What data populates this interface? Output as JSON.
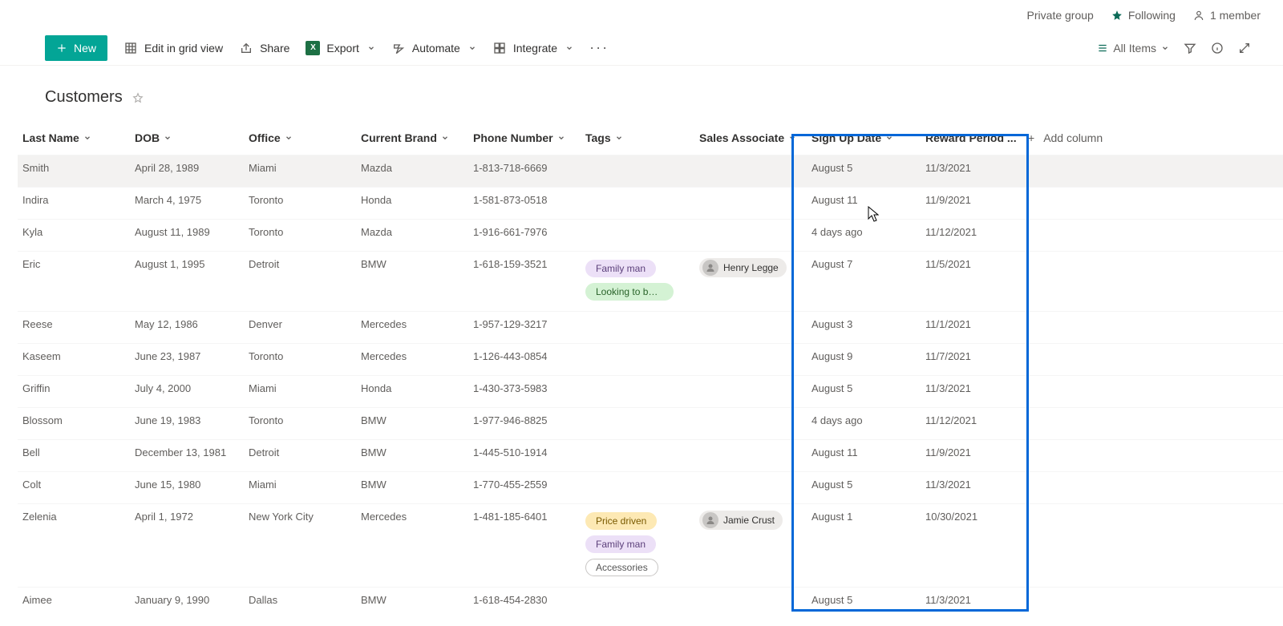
{
  "suite": {
    "private_label": "Private group",
    "following_label": "Following",
    "members_label": "1 member"
  },
  "cmdbar": {
    "new": "New",
    "edit_grid": "Edit in grid view",
    "share": "Share",
    "export": "Export",
    "automate": "Automate",
    "integrate": "Integrate",
    "view_label": "All Items"
  },
  "list": {
    "title": "Customers"
  },
  "columns": {
    "last_name": "Last Name",
    "dob": "DOB",
    "office": "Office",
    "brand": "Current Brand",
    "phone": "Phone Number",
    "tags": "Tags",
    "assoc": "Sales Associate",
    "signup": "Sign Up Date",
    "reward": "Reward Period ...",
    "addcol": "Add column"
  },
  "tag_labels": {
    "family": "Family man",
    "looking": "Looking to buy s...",
    "price": "Price driven",
    "acc": "Accessories"
  },
  "people": {
    "henry": "Henry Legge",
    "jamie": "Jamie Crust"
  },
  "rows": [
    {
      "ln": "Smith",
      "dob": "April 28, 1989",
      "office": "Miami",
      "brand": "Mazda",
      "phone": "1-813-718-6669",
      "tags": [],
      "assoc": "",
      "signup": "August 5",
      "reward": "11/3/2021"
    },
    {
      "ln": "Indira",
      "dob": "March 4, 1975",
      "office": "Toronto",
      "brand": "Honda",
      "phone": "1-581-873-0518",
      "tags": [],
      "assoc": "",
      "signup": "August 11",
      "reward": "11/9/2021"
    },
    {
      "ln": "Kyla",
      "dob": "August 11, 1989",
      "office": "Toronto",
      "brand": "Mazda",
      "phone": "1-916-661-7976",
      "tags": [],
      "assoc": "",
      "signup": "4 days ago",
      "reward": "11/12/2021"
    },
    {
      "ln": "Eric",
      "dob": "August 1, 1995",
      "office": "Detroit",
      "brand": "BMW",
      "phone": "1-618-159-3521",
      "tags": [
        "family",
        "looking"
      ],
      "assoc": "henry",
      "signup": "August 7",
      "reward": "11/5/2021"
    },
    {
      "ln": "Reese",
      "dob": "May 12, 1986",
      "office": "Denver",
      "brand": "Mercedes",
      "phone": "1-957-129-3217",
      "tags": [],
      "assoc": "",
      "signup": "August 3",
      "reward": "11/1/2021"
    },
    {
      "ln": "Kaseem",
      "dob": "June 23, 1987",
      "office": "Toronto",
      "brand": "Mercedes",
      "phone": "1-126-443-0854",
      "tags": [],
      "assoc": "",
      "signup": "August 9",
      "reward": "11/7/2021"
    },
    {
      "ln": "Griffin",
      "dob": "July 4, 2000",
      "office": "Miami",
      "brand": "Honda",
      "phone": "1-430-373-5983",
      "tags": [],
      "assoc": "",
      "signup": "August 5",
      "reward": "11/3/2021"
    },
    {
      "ln": "Blossom",
      "dob": "June 19, 1983",
      "office": "Toronto",
      "brand": "BMW",
      "phone": "1-977-946-8825",
      "tags": [],
      "assoc": "",
      "signup": "4 days ago",
      "reward": "11/12/2021"
    },
    {
      "ln": "Bell",
      "dob": "December 13, 1981",
      "office": "Detroit",
      "brand": "BMW",
      "phone": "1-445-510-1914",
      "tags": [],
      "assoc": "",
      "signup": "August 11",
      "reward": "11/9/2021"
    },
    {
      "ln": "Colt",
      "dob": "June 15, 1980",
      "office": "Miami",
      "brand": "BMW",
      "phone": "1-770-455-2559",
      "tags": [],
      "assoc": "",
      "signup": "August 5",
      "reward": "11/3/2021"
    },
    {
      "ln": "Zelenia",
      "dob": "April 1, 1972",
      "office": "New York City",
      "brand": "Mercedes",
      "phone": "1-481-185-6401",
      "tags": [
        "price",
        "family",
        "acc"
      ],
      "assoc": "jamie",
      "signup": "August 1",
      "reward": "10/30/2021"
    },
    {
      "ln": "Aimee",
      "dob": "January 9, 1990",
      "office": "Dallas",
      "brand": "BMW",
      "phone": "1-618-454-2830",
      "tags": [],
      "assoc": "",
      "signup": "August 5",
      "reward": "11/3/2021"
    }
  ]
}
